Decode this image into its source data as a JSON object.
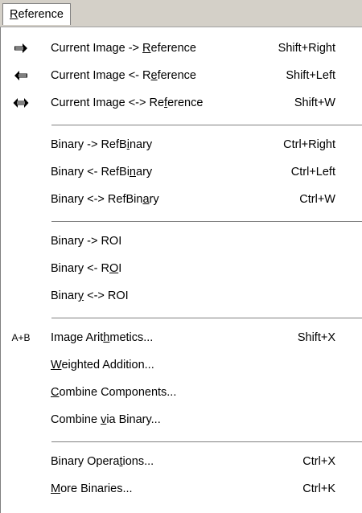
{
  "menu_title": "Reference",
  "items": [
    {
      "icon": "arrow-right-icon",
      "label_pre": "Current Image -> ",
      "mnemonic": "R",
      "label_post": "eference",
      "shortcut": "Shift+Right"
    },
    {
      "icon": "arrow-left-icon",
      "label_pre": "Current Image <- R",
      "mnemonic": "e",
      "label_post": "ference",
      "shortcut": "Shift+Left"
    },
    {
      "icon": "arrow-both-icon",
      "label_pre": "Current Image <-> Re",
      "mnemonic": "f",
      "label_post": "erence",
      "shortcut": "Shift+W"
    },
    {
      "icon": "",
      "label_pre": "Binary -> RefB",
      "mnemonic": "i",
      "label_post": "nary",
      "shortcut": "Ctrl+Right"
    },
    {
      "icon": "",
      "label_pre": "Binary <- RefBi",
      "mnemonic": "n",
      "label_post": "ary",
      "shortcut": "Ctrl+Left"
    },
    {
      "icon": "",
      "label_pre": "Binary <-> RefBin",
      "mnemonic": "a",
      "label_post": "ry",
      "shortcut": "Ctrl+W"
    },
    {
      "icon": "",
      "label_pre": "Binary -> ROI",
      "mnemonic": "",
      "label_post": "",
      "shortcut": ""
    },
    {
      "icon": "",
      "label_pre": "Binary <- R",
      "mnemonic": "O",
      "label_post": "I",
      "shortcut": ""
    },
    {
      "icon": "",
      "label_pre": "Binar",
      "mnemonic": "y",
      "label_post": " <-> ROI",
      "shortcut": ""
    },
    {
      "icon": "a-plus-b-icon",
      "icon_text": "A+B",
      "label_pre": "Image Arit",
      "mnemonic": "h",
      "label_post": "metics...",
      "shortcut": "Shift+X"
    },
    {
      "icon": "",
      "label_pre": "",
      "mnemonic": "W",
      "label_post": "eighted Addition...",
      "shortcut": ""
    },
    {
      "icon": "",
      "label_pre": "",
      "mnemonic": "C",
      "label_post": "ombine Components...",
      "shortcut": ""
    },
    {
      "icon": "",
      "label_pre": "Combine ",
      "mnemonic": "v",
      "label_post": "ia Binary...",
      "shortcut": ""
    },
    {
      "icon": "",
      "label_pre": "Binary Opera",
      "mnemonic": "t",
      "label_post": "ions...",
      "shortcut": "Ctrl+X"
    },
    {
      "icon": "",
      "label_pre": "",
      "mnemonic": "M",
      "label_post": "ore Binaries...",
      "shortcut": "Ctrl+K"
    }
  ]
}
